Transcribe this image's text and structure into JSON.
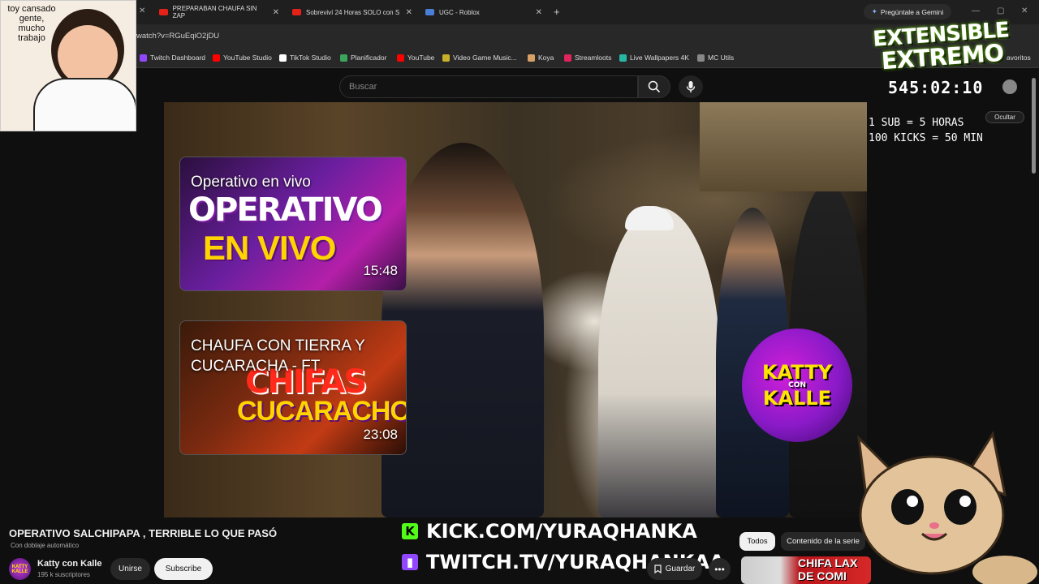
{
  "browser": {
    "tabs": [
      {
        "label": "PREPARABAN CHAUFA SIN ZAP"
      },
      {
        "label": "Sobreviví 24 Horas SOLO con S"
      },
      {
        "label": "UGC - Roblox"
      }
    ],
    "new_tab": "+",
    "gemini_button": "Pregúntale a Gemini",
    "url": "watch?v=RGuEqiO2jDU",
    "bookmarks": [
      {
        "label": "Twitch Dashboard",
        "color": "#9146ff"
      },
      {
        "label": "YouTube Studio",
        "color": "#ff0000"
      },
      {
        "label": "TikTok Studio",
        "color": "#ffffff"
      },
      {
        "label": "Planificador",
        "color": "#3ba55d"
      },
      {
        "label": "YouTube",
        "color": "#ff0000"
      },
      {
        "label": "Video Game Music...",
        "color": "#c8b02a"
      },
      {
        "label": "Koya",
        "color": "#d9a066"
      },
      {
        "label": "Streamloots",
        "color": "#e2245c"
      },
      {
        "label": "Live Wallpapers 4K",
        "color": "#26b8a5"
      },
      {
        "label": "MC Utils",
        "color": "#888888"
      }
    ],
    "favorites_label": "avoritos"
  },
  "youtube": {
    "search_placeholder": "Buscar",
    "video_title": "OPERATIVO SALCHIPAPA , TERRIBLE LO QUE PASÓ",
    "dubbing": "Con doblaje automático",
    "channel_name": "Katty con Kalle",
    "subscribers": "195 k suscriptores",
    "channel_avatar_text": "KATTY KALLE",
    "join_label": "Unirse",
    "subscribe_label": "Subscribe",
    "save_label": "Guardar",
    "chips": [
      "Todos",
      "Contenido de la serie"
    ],
    "next_thumb_text": "CHIFA LAX DE COMI",
    "end_cards": [
      {
        "title": "Operativo en vivo",
        "duration": "15:48",
        "art_line1": "OPERATIVO",
        "art_line2": "EN VIVO"
      },
      {
        "title": "CHAUFA CON TIERRA Y CUCARACHA - FT",
        "duration": "23:08",
        "art_line1": "CHIFAS",
        "art_line2": "CUCARACHOS"
      }
    ]
  },
  "stream_overlay": {
    "facecam_caption": "toy cansado gente, mucho trabajo",
    "event_title_line1": "EXTENSIBLE",
    "event_title_line2": "EXTREMO",
    "timer": "545:02:10",
    "rule1": "1 SUB = 5 HORAS",
    "rule2": "100 KICKS = 50 MIN",
    "hide_button": "Ocultar",
    "logo_line1": "KATTY",
    "logo_con": "CON",
    "logo_line2": "KALLE",
    "kick_link": "KICK.COM/YURAQHANKA",
    "twitch_link": "TWITCH.TV/YURAQHANKAA",
    "kick_color": "#53fc18",
    "twitch_color": "#9146ff"
  }
}
